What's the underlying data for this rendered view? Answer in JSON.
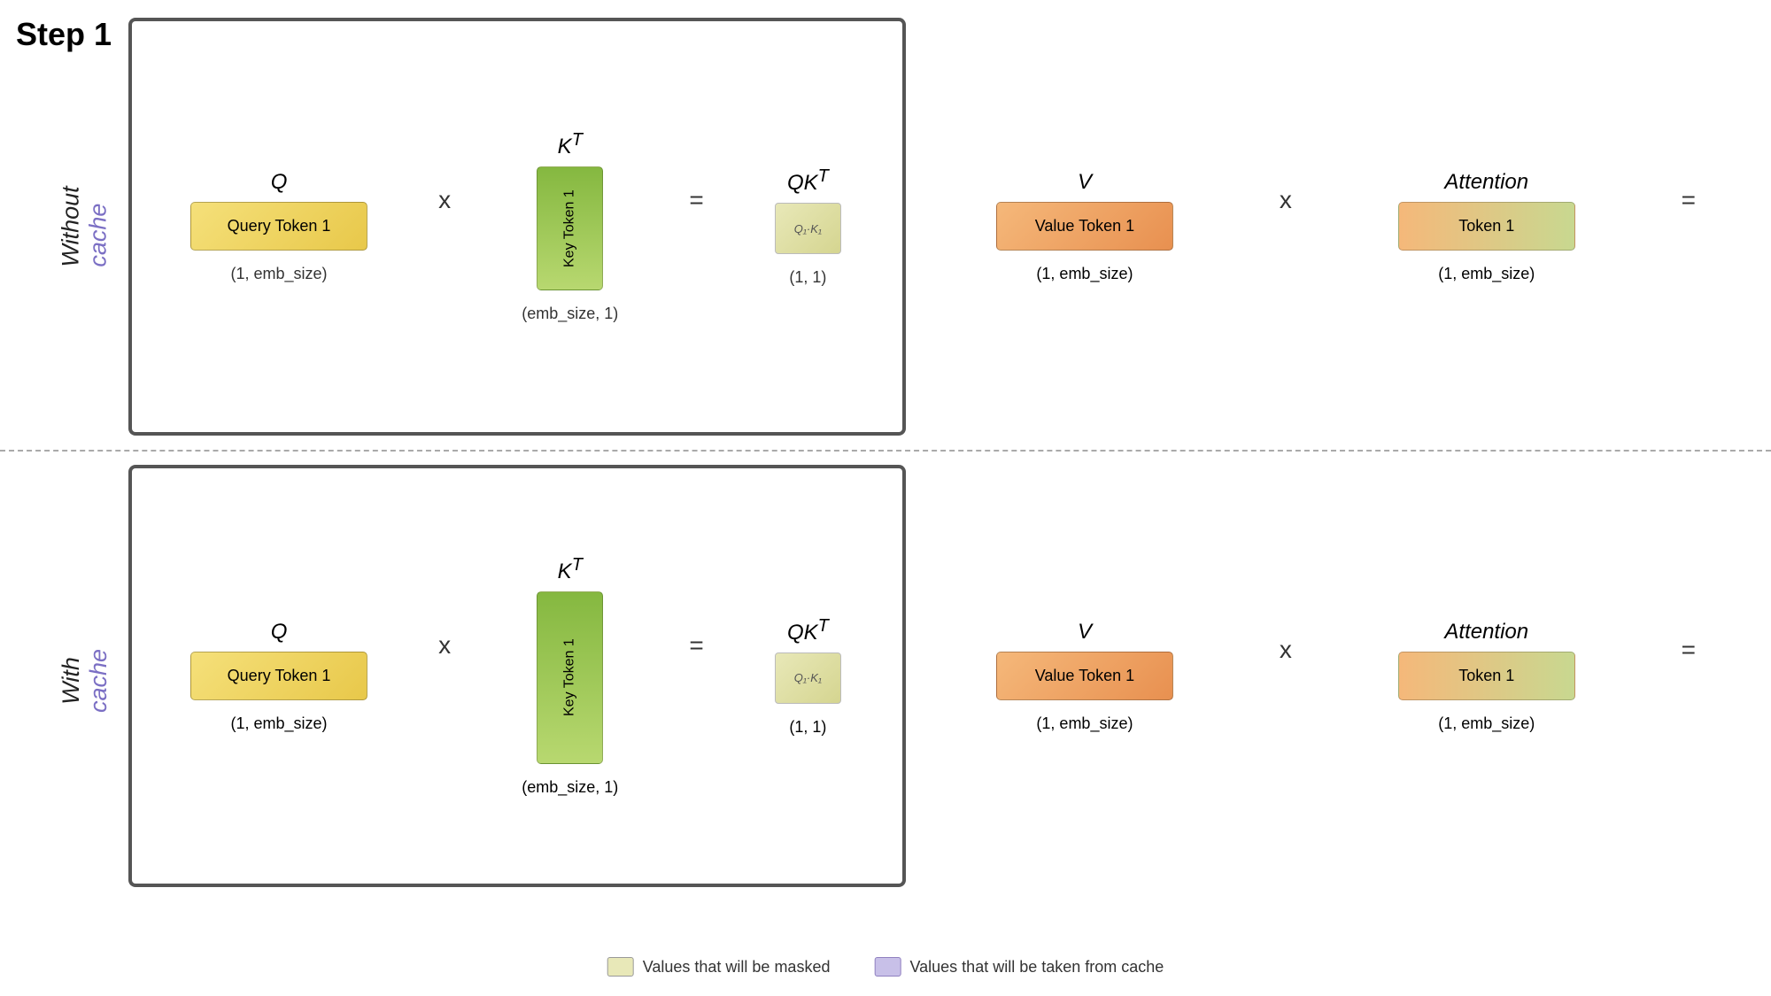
{
  "page": {
    "step_label": "Step 1",
    "divider_style": "dashed",
    "sections": [
      {
        "id": "top",
        "side_label_line1": "Without",
        "side_label_line2": "cache",
        "left_part": {
          "q_header": "Q",
          "kt_header": "K",
          "kt_sup": "T",
          "qkt_header": "QK",
          "qkt_sup": "T",
          "query_token_label": "Query Token 1",
          "key_token_label": "Key Token 1",
          "qk_result_label": "Q₁·K₁",
          "q_dim": "(1, emb_size)",
          "kt_dim": "(emb_size, 1)",
          "qkt_dim": "(1, 1)",
          "operator": "x",
          "equals": "="
        },
        "right_part": {
          "v_header": "V",
          "attention_header": "Attention",
          "value_token_label": "Value Token 1",
          "attention_token_label": "Token 1",
          "v_dim": "(1, emb_size)",
          "attention_dim": "(1, emb_size)",
          "operator": "x",
          "equals": "="
        }
      },
      {
        "id": "bottom",
        "side_label_line1": "With",
        "side_label_line2": "cache",
        "left_part": {
          "q_header": "Q",
          "kt_header": "K",
          "kt_sup": "T",
          "qkt_header": "QK",
          "qkt_sup": "T",
          "query_token_label": "Query Token 1",
          "key_token_label": "Key Token 1",
          "qk_result_label": "Q₁·K₁",
          "q_dim": "(1, emb_size)",
          "kt_dim": "(emb_size, 1)",
          "qkt_dim": "(1, 1)",
          "operator": "x",
          "equals": "="
        },
        "right_part": {
          "v_header": "V",
          "attention_header": "Attention",
          "value_token_label": "Value Token 1",
          "attention_token_label": "Token 1",
          "v_dim": "(1, emb_size)",
          "attention_dim": "(1, emb_size)",
          "operator": "x",
          "equals": "="
        }
      }
    ],
    "legend": {
      "masked_label": "Values that will be masked",
      "cache_label": "Values that will be taken from cache"
    }
  }
}
